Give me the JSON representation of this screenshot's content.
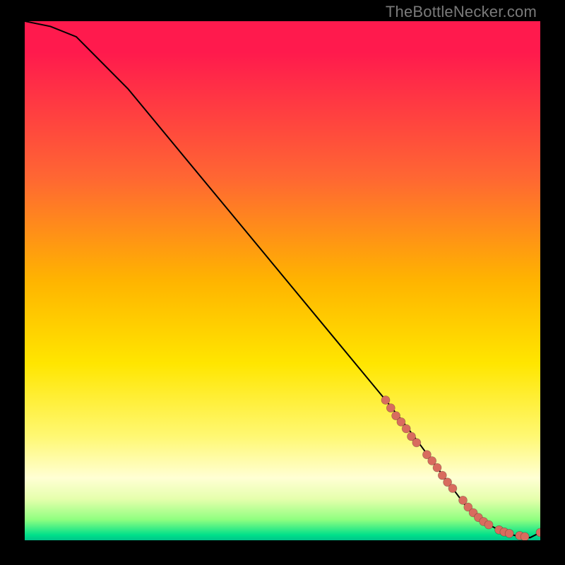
{
  "watermark": "TheBottleNecker.com",
  "chart_data": {
    "type": "line",
    "title": "",
    "xlabel": "",
    "ylabel": "",
    "xlim": [
      0,
      100
    ],
    "ylim": [
      0,
      100
    ],
    "curve": {
      "name": "bottleneck-curve",
      "x": [
        0,
        5,
        10,
        20,
        30,
        40,
        50,
        60,
        70,
        74,
        77,
        80,
        83,
        86,
        88,
        90,
        92,
        94,
        96,
        98,
        100
      ],
      "y": [
        100,
        99,
        97,
        87,
        75,
        63,
        51,
        39,
        27,
        22,
        18,
        14,
        10,
        6,
        4,
        3,
        2,
        1.2,
        0.7,
        0.5,
        1.5
      ]
    },
    "points": {
      "name": "sample-points",
      "x": [
        70,
        71,
        72,
        73,
        74,
        75,
        76,
        78,
        79,
        80,
        81,
        82,
        83,
        85,
        86,
        87,
        88,
        89,
        90,
        92,
        93,
        94,
        96,
        97,
        100
      ],
      "y": [
        27,
        25.5,
        24,
        22.8,
        21.5,
        20,
        18.8,
        16.5,
        15.3,
        14,
        12.5,
        11.2,
        10,
        7.7,
        6.4,
        5.3,
        4.4,
        3.6,
        3,
        2,
        1.6,
        1.3,
        0.9,
        0.7,
        1.5
      ]
    }
  }
}
